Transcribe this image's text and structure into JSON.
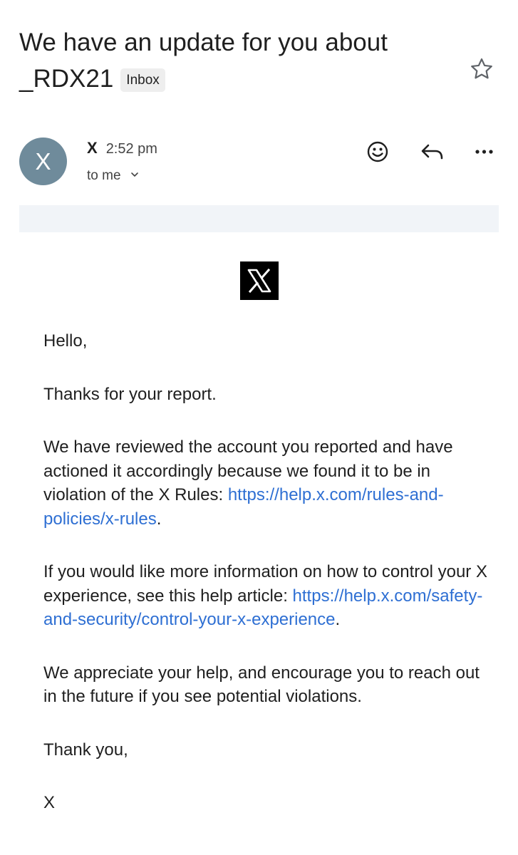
{
  "email": {
    "subject": "We have an update for you about _RDX21",
    "label": "Inbox",
    "sender": {
      "avatar_letter": "X",
      "name": "X",
      "time": "2:52 pm",
      "recipient": "to me"
    },
    "body": {
      "greeting": "Hello,",
      "thanks": "Thanks for your report.",
      "para1_text": "We have reviewed the account you reported and have actioned it accordingly because we found it to be in violation of the X Rules: ",
      "para1_link": "https://help.x.com/rules-and-policies/x-rules",
      "para1_end": ".",
      "para2_text": "If you would like more information on how to control your X experience, see this help article: ",
      "para2_link": "https://help.x.com/safety-and-security/control-your-x-experience",
      "para2_end": ".",
      "para3": "We appreciate your help, and encourage you to reach out in the future if you see potential violations.",
      "signoff": "Thank you,",
      "signature": "X"
    }
  },
  "icons": {
    "star": "star-icon",
    "emoji": "emoji-reaction-icon",
    "reply": "reply-icon",
    "more": "more-options-icon",
    "logo": "x-logo-icon",
    "chevron": "chevron-down-icon"
  },
  "colors": {
    "avatar_bg": "#6f8b9b",
    "link": "#2e6fd3",
    "banner_bg": "#f1f4f8",
    "chip_bg": "#eeeeee"
  }
}
